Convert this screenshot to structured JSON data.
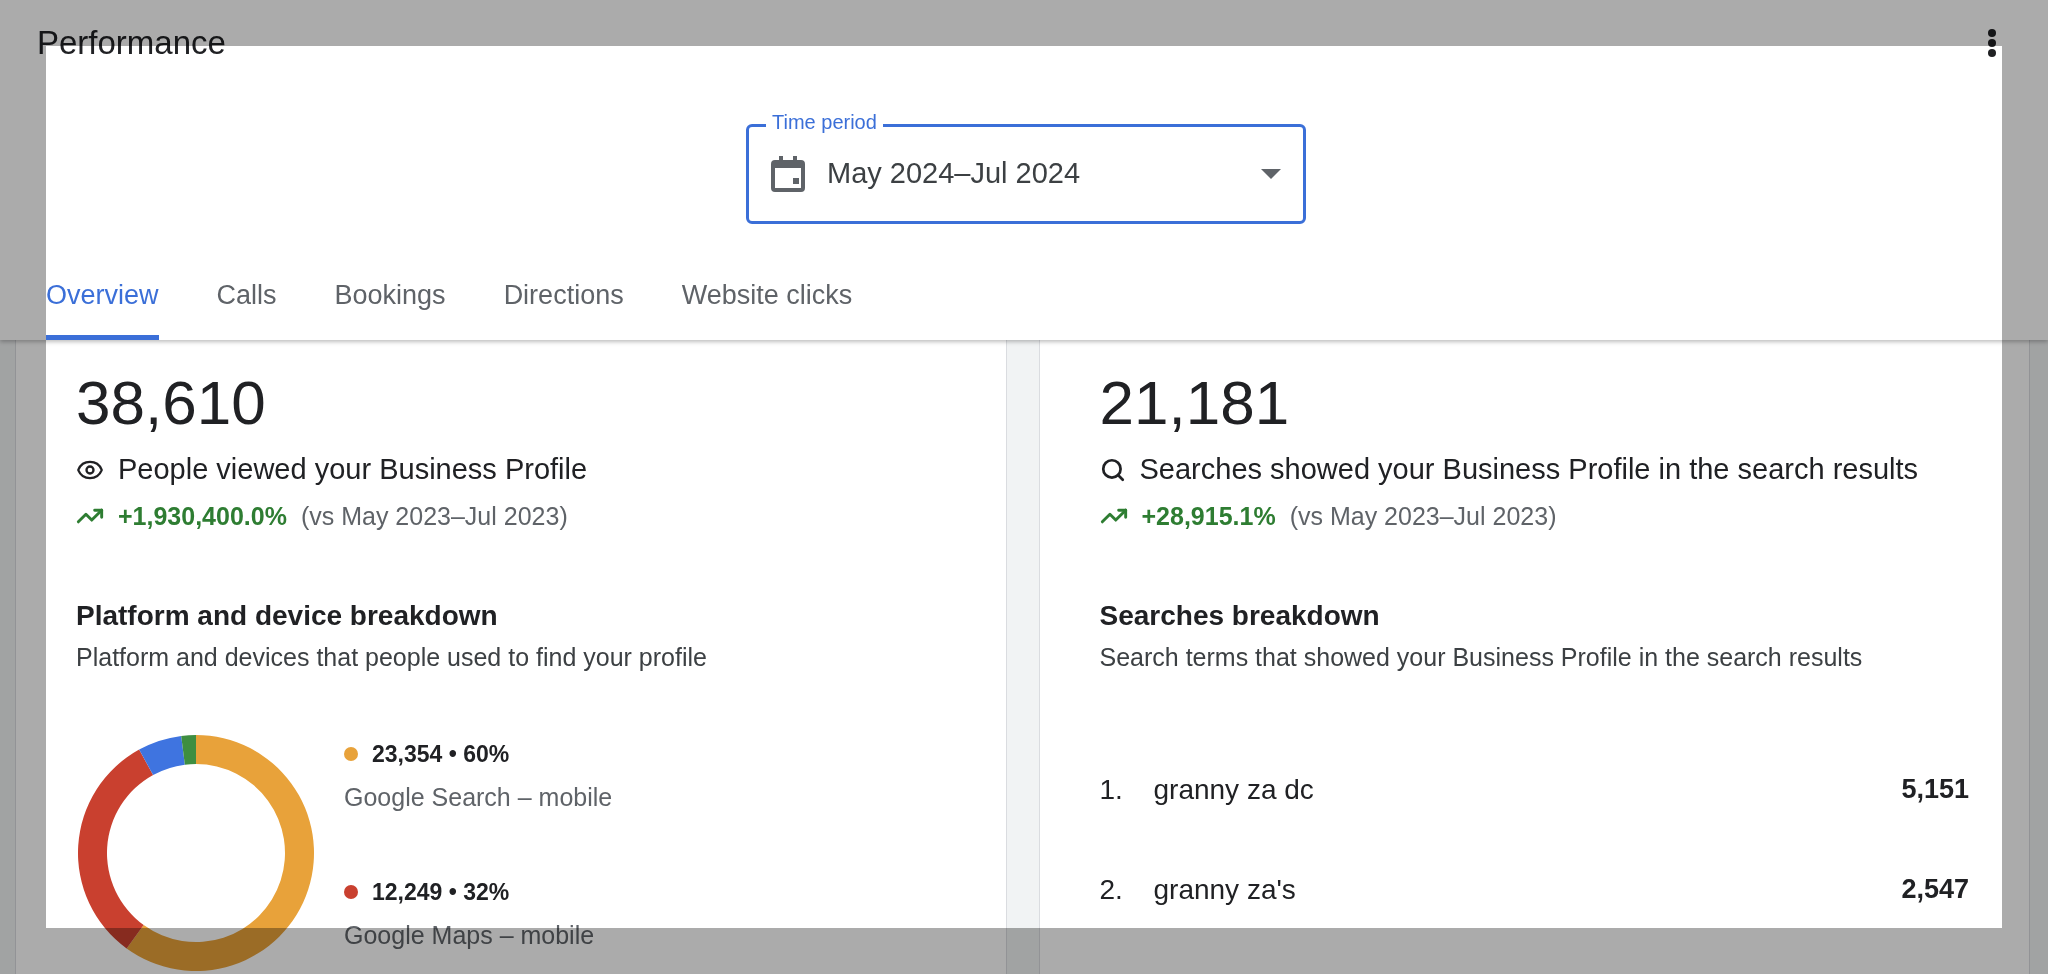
{
  "header": {
    "title": "Performance"
  },
  "time_period": {
    "label": "Time period",
    "value": "May 2024–Jul 2024"
  },
  "tabs": [
    {
      "label": "Overview",
      "selected": true
    },
    {
      "label": "Calls",
      "selected": false
    },
    {
      "label": "Bookings",
      "selected": false
    },
    {
      "label": "Directions",
      "selected": false
    },
    {
      "label": "Website clicks",
      "selected": false
    }
  ],
  "cards": [
    {
      "kind": "views",
      "total": "38,610",
      "caption": "People viewed your Business Profile",
      "change": "+1,930,400.0%",
      "comparison": "(vs May 2023–Jul 2023)",
      "section_title": "Platform and device breakdown",
      "section_subtitle": "Platform and devices that people used to find your profile",
      "legend": [
        {
          "value": "23,354 • 60%",
          "label": "Google Search – mobile",
          "color": "#e8a23a"
        },
        {
          "value": "12,249 • 32%",
          "label": "Google Maps – mobile",
          "color": "#c9402f"
        }
      ],
      "chart_data": {
        "type": "donut",
        "values": [
          60,
          32,
          6,
          2
        ],
        "colors": [
          "#e8a23a",
          "#c9402f",
          "#3f74e0",
          "#3e8e41"
        ]
      }
    },
    {
      "kind": "searches",
      "total": "21,181",
      "caption": "Searches showed your Business Profile in the search results",
      "change": "+28,915.1%",
      "comparison": "(vs May 2023–Jul 2023)",
      "section_title": "Searches breakdown",
      "section_subtitle": "Search terms that showed your Business Profile in the search results",
      "terms": [
        {
          "rank": "1.",
          "term": "granny za dc",
          "count": "5,151"
        },
        {
          "rank": "2.",
          "term": "granny za's",
          "count": "2,547"
        }
      ]
    }
  ]
}
